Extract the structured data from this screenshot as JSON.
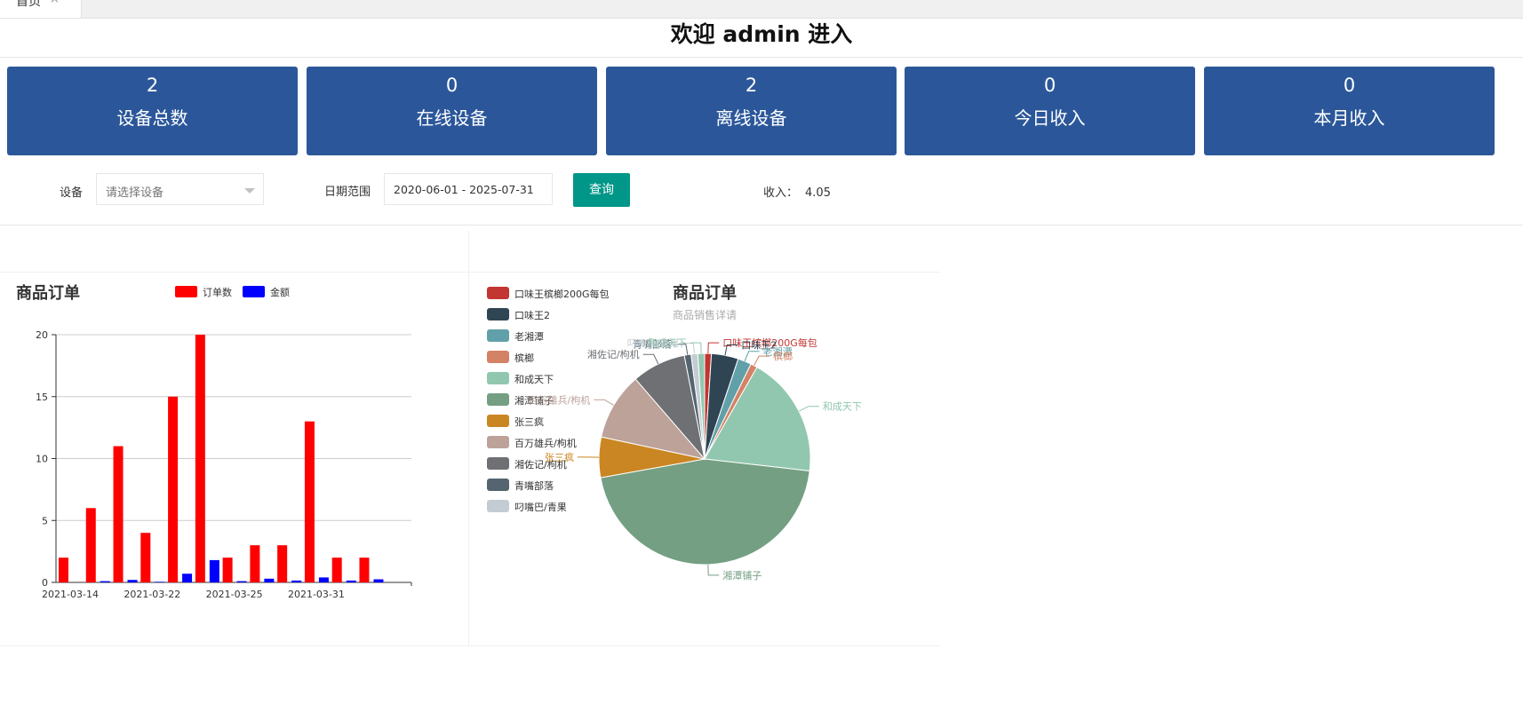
{
  "tab": {
    "label": "首页",
    "close": "×"
  },
  "welcome": "欢迎 admin 进入",
  "stats": [
    {
      "value": "2",
      "label": "设备总数"
    },
    {
      "value": "0",
      "label": "在线设备"
    },
    {
      "value": "2",
      "label": "离线设备"
    },
    {
      "value": "0",
      "label": "今日收入"
    },
    {
      "value": "0",
      "label": "本月收入"
    }
  ],
  "filter": {
    "device_label": "设备",
    "device_placeholder": "请选择设备",
    "date_label": "日期范围",
    "date_value": "2020-06-01 - 2025-07-31",
    "query_button": "查询",
    "income_label": "收入：",
    "income_value": "4.05"
  },
  "colors": {
    "card": "#2b579a",
    "button": "#009688",
    "orders": "#ff0000",
    "amount": "#0000ff"
  },
  "chart_data": [
    {
      "type": "bar",
      "title": "商品订单",
      "categories": [
        "2021-03-14",
        "",
        "",
        "2021-03-22",
        "",
        "",
        "2021-03-25",
        "",
        "",
        "2021-03-31",
        "",
        "",
        ""
      ],
      "series": [
        {
          "name": "订单数",
          "values": [
            2,
            6,
            11,
            4,
            15,
            20,
            2,
            3,
            3,
            13,
            2,
            2,
            0
          ],
          "color": "#ff0000"
        },
        {
          "name": "金额",
          "values": [
            0,
            0.1,
            0.2,
            0.05,
            0.7,
            1.8,
            0.1,
            0.3,
            0.15,
            0.4,
            0.15,
            0.25,
            0
          ],
          "color": "#0000ff"
        }
      ],
      "yticks": [
        0,
        5,
        10,
        15,
        20
      ],
      "ylim": [
        0,
        20
      ],
      "grid": true,
      "legend": "top"
    },
    {
      "type": "pie",
      "title": "商品订单",
      "subtitle": "商品销售详请",
      "legend": "left",
      "slices": [
        {
          "name": "口味王槟榔200G每包",
          "value": 1,
          "color": "#c23531"
        },
        {
          "name": "口味王2",
          "value": 4,
          "color": "#2f4554"
        },
        {
          "name": "老湘潭",
          "value": 2,
          "color": "#61a0a8"
        },
        {
          "name": "槟榔",
          "value": 1,
          "color": "#d48265"
        },
        {
          "name": "和成天下",
          "value": 18,
          "color": "#91c7ae"
        },
        {
          "name": "湘潭铺子",
          "value": 44,
          "color": "#749f83"
        },
        {
          "name": "张三疯",
          "value": 6,
          "color": "#ca8622"
        },
        {
          "name": "百万雄兵/枸机",
          "value": 10,
          "color": "#bda29a"
        },
        {
          "name": "湘佐记/枸机",
          "value": 8,
          "color": "#6e7074"
        },
        {
          "name": "青嘴部落",
          "value": 1,
          "color": "#546570"
        },
        {
          "name": "叼嘴巴/青果",
          "value": 1,
          "color": "#c4ccd3"
        },
        {
          "name": "和成天下",
          "value": 1,
          "color": "#91c7ae"
        }
      ]
    }
  ]
}
